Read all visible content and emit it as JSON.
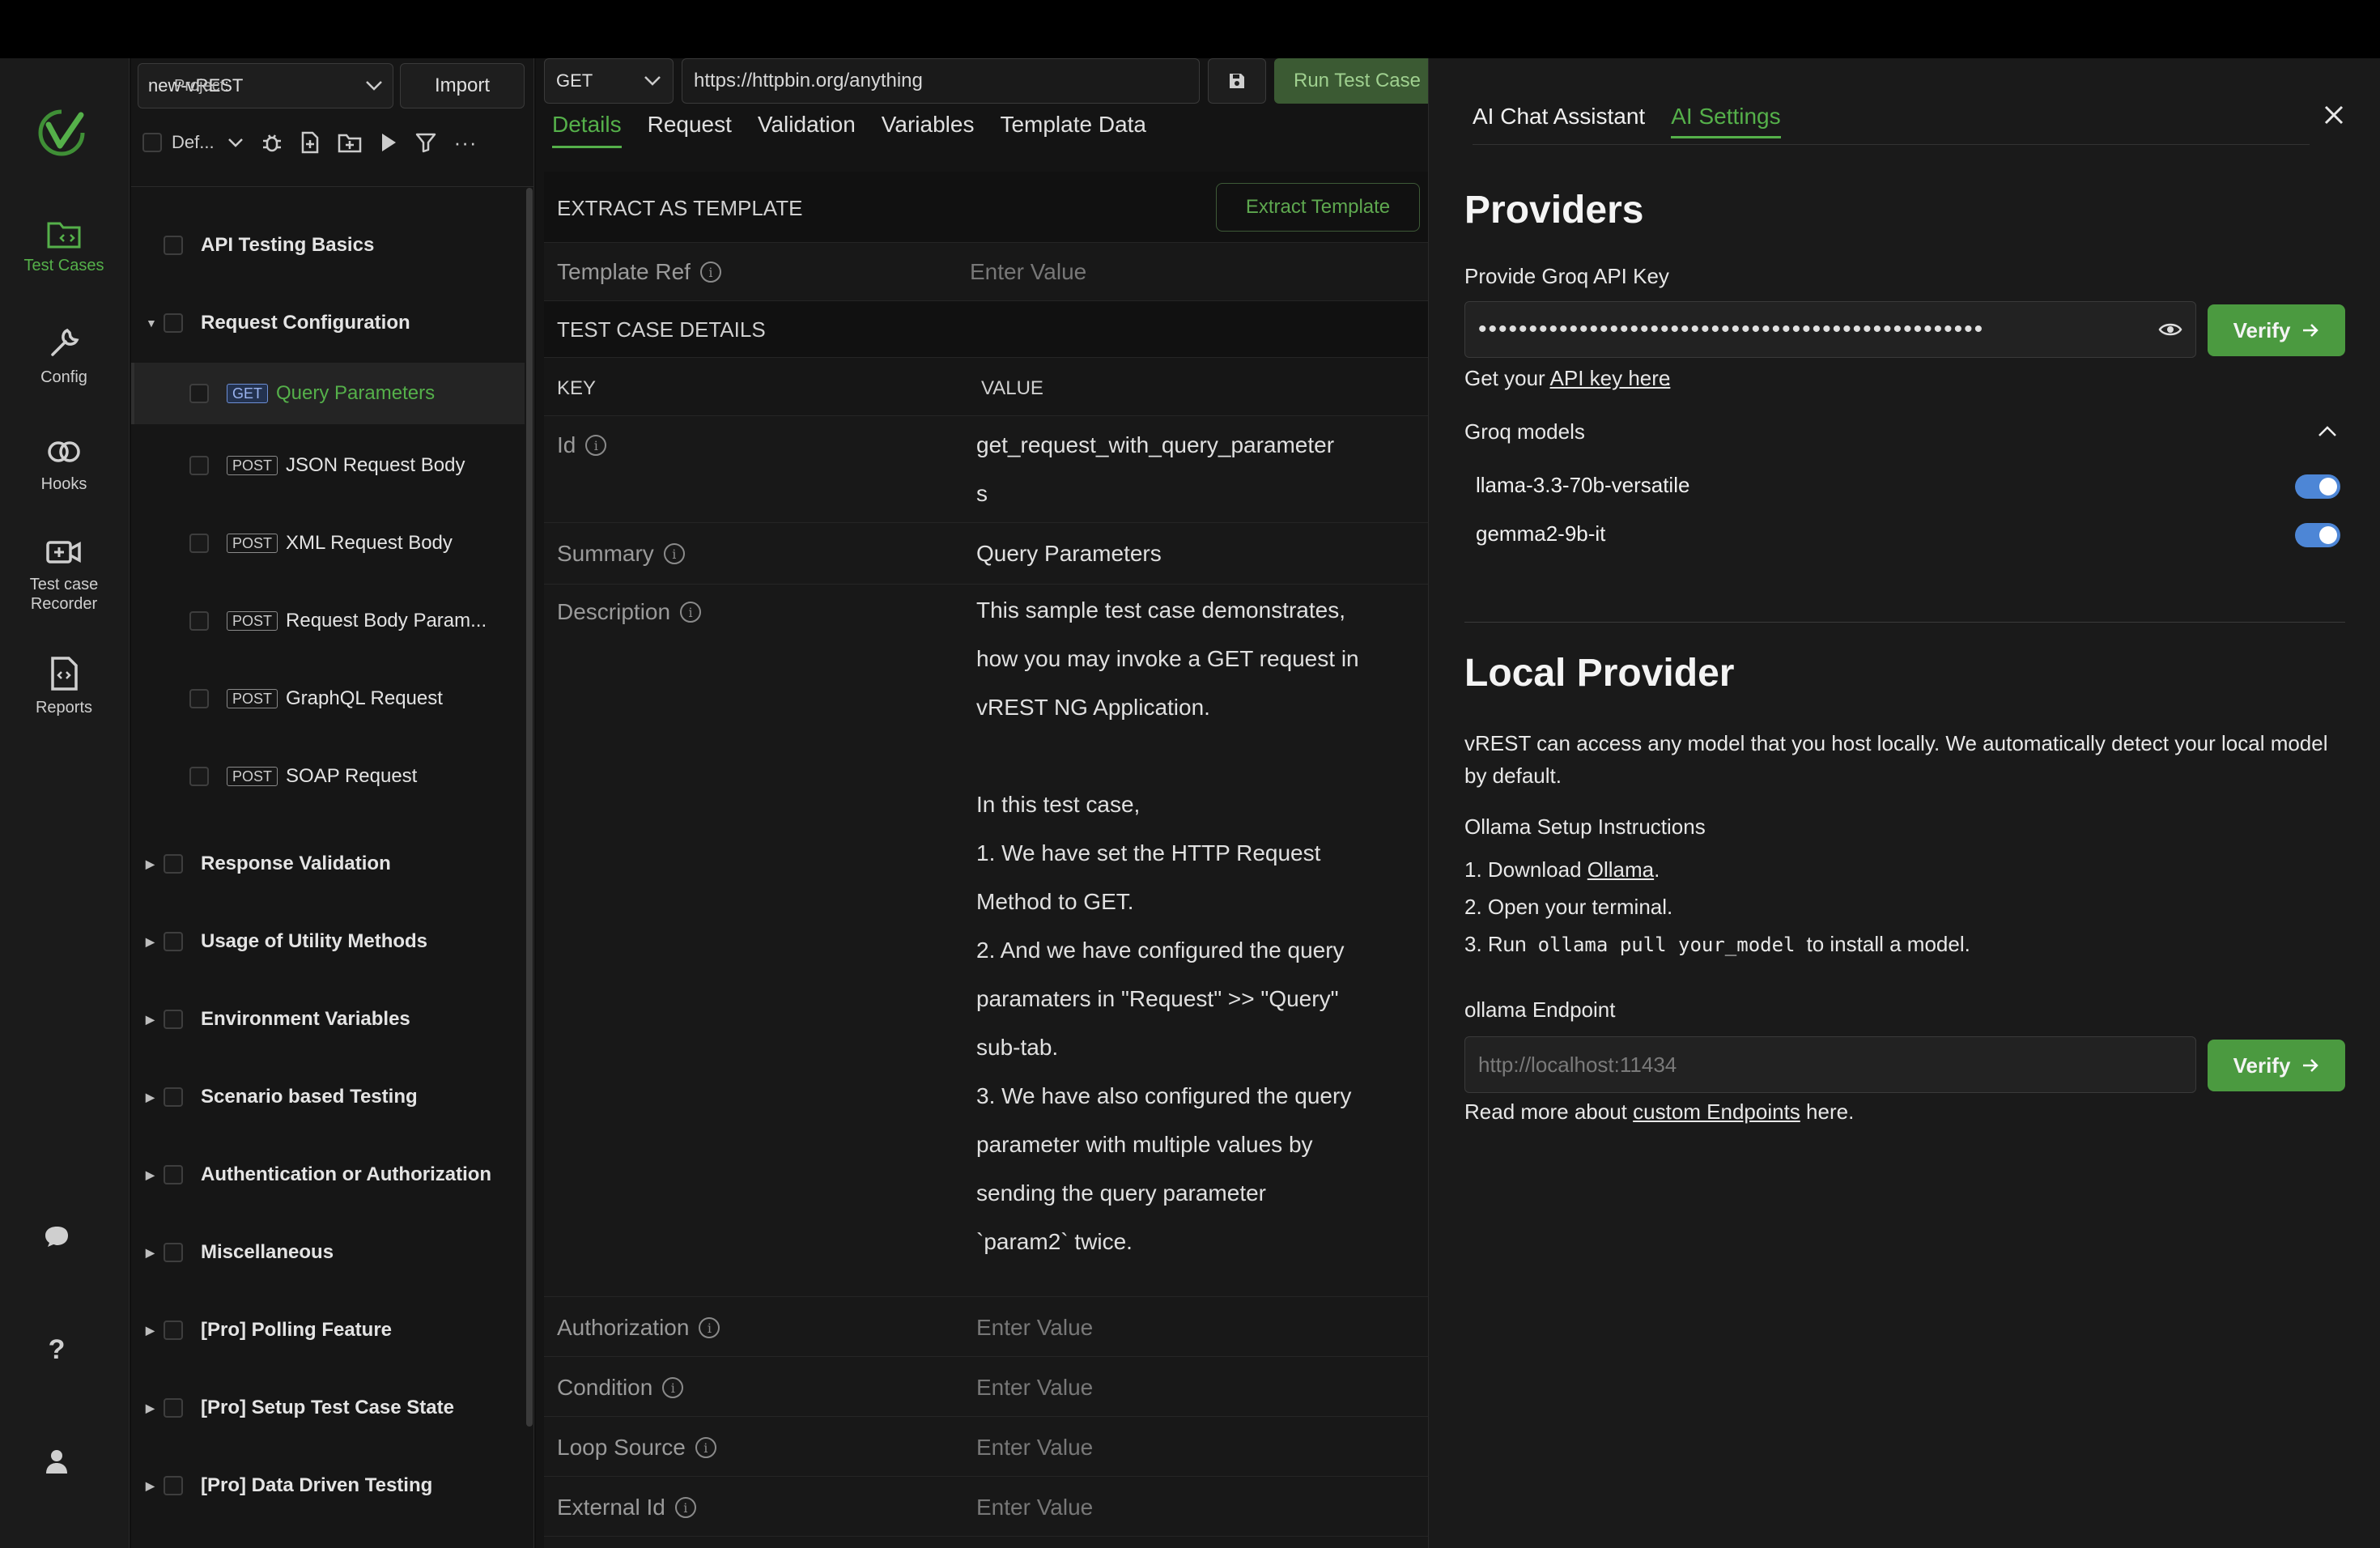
{
  "rail": {
    "items": [
      {
        "label": "Test Cases"
      },
      {
        "label": "Config"
      },
      {
        "label": "Hooks"
      },
      {
        "label": "Test case Recorder"
      },
      {
        "label": "Reports"
      }
    ]
  },
  "tree": {
    "project_label": "Project:",
    "project_value": "new-vREST",
    "import_label": "Import",
    "filter_value": "Def...",
    "nodes": [
      {
        "label": "API Testing Basics"
      },
      {
        "label": "Request Configuration"
      },
      {
        "method": "GET",
        "label": "Query Parameters"
      },
      {
        "method": "POST",
        "label": "JSON Request Body"
      },
      {
        "method": "POST",
        "label": "XML Request Body"
      },
      {
        "method": "POST",
        "label": "Request Body Param..."
      },
      {
        "method": "POST",
        "label": "GraphQL Request"
      },
      {
        "method": "POST",
        "label": "SOAP Request"
      },
      {
        "label": "Response Validation"
      },
      {
        "label": "Usage of Utility Methods"
      },
      {
        "label": "Environment Variables"
      },
      {
        "label": "Scenario based Testing"
      },
      {
        "label": "Authentication or Authorization"
      },
      {
        "label": "Miscellaneous"
      },
      {
        "label": "[Pro] Polling Feature"
      },
      {
        "label": "[Pro] Setup Test Case State"
      },
      {
        "label": "[Pro] Data Driven Testing"
      }
    ]
  },
  "editor": {
    "method": "GET",
    "url": "https://httpbin.org/anything",
    "run_label": "Run Test Case",
    "tabs": [
      "Details",
      "Request",
      "Validation",
      "Variables",
      "Template Data"
    ],
    "extract_header": "EXTRACT AS TEMPLATE",
    "extract_button": "Extract Template",
    "template_ref_label": "Template Ref",
    "enter_value": "Enter Value",
    "details_header": "TEST CASE DETAILS",
    "col_key": "KEY",
    "col_value": "VALUE",
    "id_label": "Id",
    "id_value_1": "get_request_with_query_parameter",
    "id_value_2": "s",
    "summary_label": "Summary",
    "summary_value": "Query Parameters",
    "description_label": "Description",
    "description_lines": [
      "This sample test case demonstrates,",
      "how you may invoke a GET request in",
      "vREST NG Application.",
      "",
      "In this test case,",
      "1. We have set the HTTP Request",
      "Method to GET.",
      "2. And we have configured the query",
      "paramaters in \"Request\" >> \"Query\"",
      "sub-tab.",
      "3. We have also configured the query",
      "parameter with multiple values by",
      "sending the query parameter",
      "`param2` twice."
    ],
    "authorization_label": "Authorization",
    "condition_label": "Condition",
    "loop_source_label": "Loop Source",
    "external_id_label": "External Id"
  },
  "ai": {
    "tab_chat": "AI Chat Assistant",
    "tab_settings": "AI Settings",
    "providers_title": "Providers",
    "groq_key_label": "Provide Groq API Key",
    "groq_key_value": "••••••••••••••••••••••••••••••••••••••••••••••••••",
    "verify_label": "Verify",
    "get_your": "Get your",
    "api_key_link": "API key here",
    "period": ".",
    "groq_models_label": "Groq models",
    "models": [
      "llama-3.3-70b-versatile",
      "gemma2-9b-it"
    ],
    "local_title": "Local Provider",
    "local_desc": "vREST can access any model that you host locally. We automatically detect your local model by default.",
    "ollama_title": "Ollama Setup Instructions",
    "step1_pre": "1. Download",
    "step1_link": "Ollama",
    "step2": "2. Open your terminal.",
    "step3_pre": "3. Run",
    "step3_code": "ollama pull your_model",
    "step3_post": "to install a model.",
    "endpoint_label": "ollama Endpoint",
    "endpoint_placeholder": "http://localhost:11434",
    "read_more_pre": "Read more about",
    "read_more_link": "custom Endpoints",
    "read_more_post": "here."
  }
}
